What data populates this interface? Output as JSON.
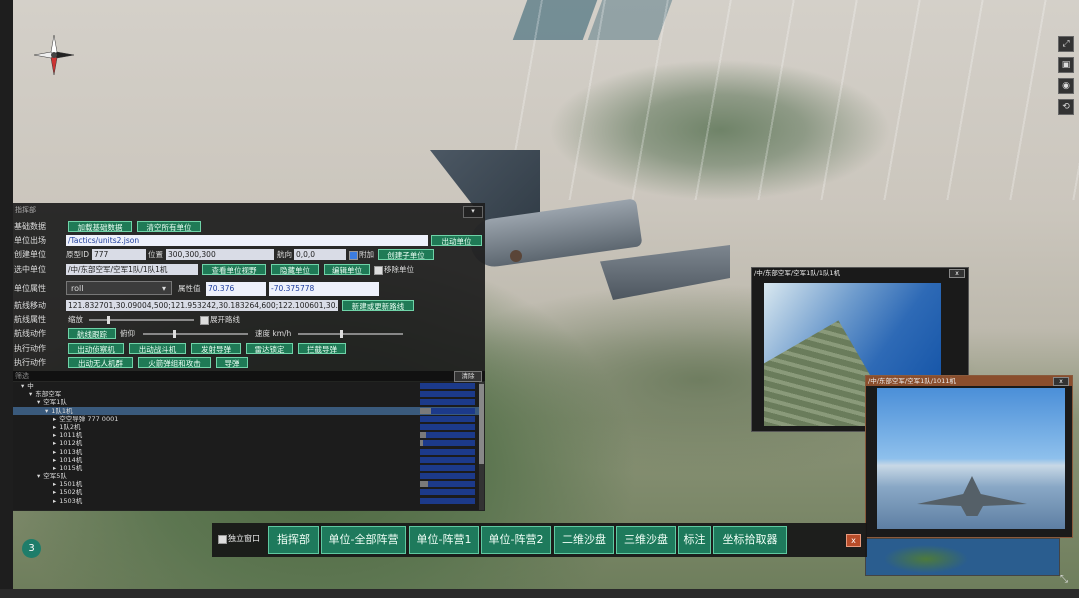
{
  "command_panel": {
    "title": "指挥部",
    "close_label": "▾",
    "rows": {
      "basic_data": {
        "label": "基础数据",
        "btn_load": "加载基础数据",
        "btn_clear": "清空所有单位"
      },
      "unit_load": {
        "label": "单位出场",
        "path_value": "/Tactics/units2.json",
        "btn_load": "出动单位"
      },
      "create_unit": {
        "label": "创建单位",
        "model_id_label": "原型ID",
        "model_id_value": "777",
        "position_label": "位置",
        "position_value": "300,300,300",
        "heading_label": "航向",
        "heading_value": "0,0,0",
        "attach_label": "附加",
        "btn_create_child": "创建子单位"
      },
      "select_unit": {
        "label": "选中单位",
        "path_value": "/中/东部空军/空军1队/1队1机",
        "btn_view": "查看单位视野",
        "btn_hide": "隐藏单位",
        "btn_edit": "编辑单位",
        "delete_label": "移除单位"
      },
      "unit_property": {
        "label": "单位属性",
        "select_value": "roll",
        "prop_value_label": "属性值",
        "prop_value": "70.376",
        "prop_value2": "-70.375778"
      },
      "route_move": {
        "label": "航线移动",
        "route_value": "121.832701,30.09004,500;121.953242,30.183264,600;122.100601,30.",
        "btn_update": "新建或更新路线"
      },
      "route_setting": {
        "label": "航线属性",
        "speed_label": "缩放",
        "flatten_label": "展开路线"
      },
      "route_action": {
        "label": "航线动作",
        "btn_follow": "航线跟踪",
        "pitch_label": "俯仰",
        "speed_label": "速度 km/h"
      },
      "fire_action1": {
        "label": "执行动作",
        "btn_1": "出动侦察机",
        "btn_2": "出动战斗机",
        "btn_3": "发射导弹",
        "btn_4": "雷达锁定",
        "btn_5": "拦截导弹"
      },
      "fire_action2": {
        "label": "执行动作",
        "btn_1": "出动无人机群",
        "btn_2": "火箭弹组和攻击",
        "btn_3": "导弹"
      }
    },
    "tree": {
      "filter_placeholder": "筛选",
      "clear_label": "清除",
      "items": [
        {
          "indent": 1,
          "text": "中",
          "arrow": "▾",
          "bar": 0,
          "sel": false
        },
        {
          "indent": 2,
          "text": "东部空军",
          "arrow": "▾",
          "bar": 0,
          "sel": false
        },
        {
          "indent": 3,
          "text": "空军1队",
          "arrow": "▾",
          "bar": 0,
          "sel": false
        },
        {
          "indent": 4,
          "text": "1队1机",
          "arrow": "▾",
          "bar": 0.2,
          "sel": true
        },
        {
          "indent": 5,
          "text": "空空导弹 777 0001",
          "arrow": "▸",
          "bar": 0,
          "sel": false
        },
        {
          "indent": 5,
          "text": "1队2机",
          "arrow": "▸",
          "bar": 0,
          "sel": false
        },
        {
          "indent": 5,
          "text": "1011机",
          "arrow": "▸",
          "bar": 0.1,
          "sel": false
        },
        {
          "indent": 5,
          "text": "1012机",
          "arrow": "▸",
          "bar": 0.05,
          "sel": false
        },
        {
          "indent": 5,
          "text": "1013机",
          "arrow": "▸",
          "bar": 0,
          "sel": false
        },
        {
          "indent": 5,
          "text": "1014机",
          "arrow": "▸",
          "bar": 0,
          "sel": false
        },
        {
          "indent": 5,
          "text": "1015机",
          "arrow": "▸",
          "bar": 0,
          "sel": false
        },
        {
          "indent": 3,
          "text": "空军5队",
          "arrow": "▾",
          "bar": 0,
          "sel": false
        },
        {
          "indent": 5,
          "text": "1501机",
          "arrow": "▸",
          "bar": 0.15,
          "sel": false
        },
        {
          "indent": 5,
          "text": "1502机",
          "arrow": "▸",
          "bar": 0,
          "sel": false
        },
        {
          "indent": 5,
          "text": "1503机",
          "arrow": "▸",
          "bar": 0,
          "sel": false
        }
      ]
    }
  },
  "video_windows": [
    {
      "title": "/中/东部空军/空军1队/1队1机",
      "close_label": "x"
    },
    {
      "title": "/中/东部空军/空军1队/1011机",
      "close_label": "x"
    }
  ],
  "toolbar": {
    "independent_window_label": "独立窗口",
    "buttons": [
      "指挥部",
      "单位-全部阵营",
      "单位-阵营1",
      "单位-阵营2",
      "二维沙盘",
      "三维沙盘",
      "标注",
      "坐标拾取器"
    ],
    "close_label": "x"
  },
  "badge_number": "3",
  "side_tools": [
    "⤢",
    "▣",
    "◉",
    "⟲"
  ],
  "colors": {
    "accent_green": "#1e7a5c",
    "panel_bg": "#1e1e1e",
    "close_red": "#b84d2a",
    "selected_row": "#3a5a7c"
  }
}
